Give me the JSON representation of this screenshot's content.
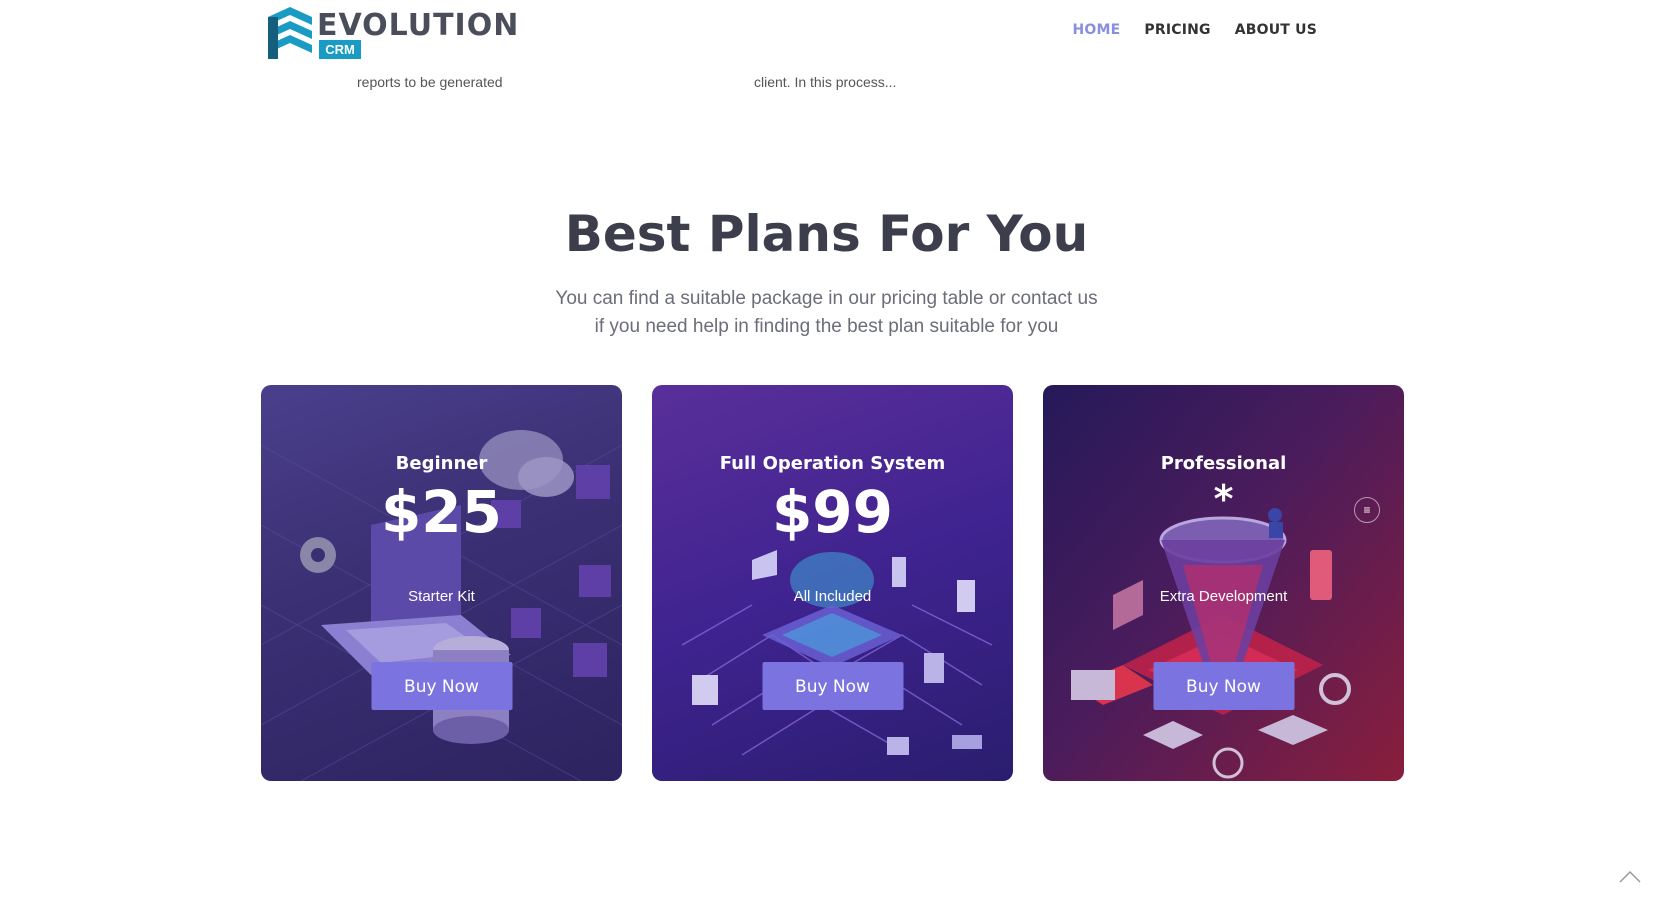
{
  "header": {
    "logo_word": "EVOLUTION",
    "logo_badge": "CRM",
    "nav": [
      {
        "label": "HOME",
        "active": true
      },
      {
        "label": "PRICING",
        "active": false
      },
      {
        "label": "ABOUT US",
        "active": false
      }
    ]
  },
  "previous_section": {
    "text_1": "reports to be generated",
    "text_2": "client. In this process..."
  },
  "pricing": {
    "title": "Best Plans For You",
    "subtitle_line1": "You can find a suitable package  in our pricing table or contact us",
    "subtitle_line2": "if you need help in finding the best plan suitable for you",
    "plans": [
      {
        "name": "Beginner",
        "price": "$25",
        "note": "Starter Kit",
        "button": "Buy Now"
      },
      {
        "name": "Full Operation System",
        "price": "$99",
        "note": "All Included",
        "button": "Buy Now"
      },
      {
        "name": "Professional",
        "price": "*",
        "note": "Extra Development",
        "button": "Buy Now"
      }
    ],
    "menu_icon": "≡"
  },
  "colors": {
    "accent": "#7b74e0",
    "nav_active": "#8a8ee0",
    "heading": "#3c3e4c",
    "logo_blue": "#1a9bc4"
  },
  "icons": [
    "logo-icon",
    "menu-icon",
    "chevron-up-icon"
  ]
}
